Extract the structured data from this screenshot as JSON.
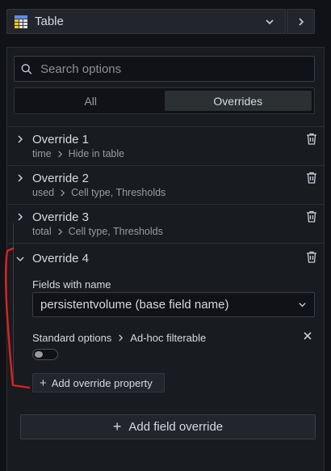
{
  "header": {
    "visualization_label": "Table",
    "viz_icon": "table-icon"
  },
  "search": {
    "placeholder": "Search options"
  },
  "tabs": [
    {
      "label": "All",
      "active": false
    },
    {
      "label": "Overrides",
      "active": true
    }
  ],
  "overrides": [
    {
      "title": "Override 1",
      "field": "time",
      "properties": "Hide in table"
    },
    {
      "title": "Override 2",
      "field": "used",
      "properties": "Cell type, Thresholds"
    },
    {
      "title": "Override 3",
      "field": "total",
      "properties": "Cell type, Thresholds"
    }
  ],
  "override4": {
    "title": "Override 4",
    "matcher_label": "Fields with name",
    "matcher_value": "persistentvolume (base field name)",
    "property_category": "Standard options",
    "property_name": "Ad-hoc filterable",
    "toggle_on": false,
    "add_property_label": "Add override property"
  },
  "footer": {
    "add_field_override_label": "Add field override"
  },
  "colors": {
    "background": "#111217",
    "panel": "#181b1f",
    "annotation": "#e02020"
  }
}
